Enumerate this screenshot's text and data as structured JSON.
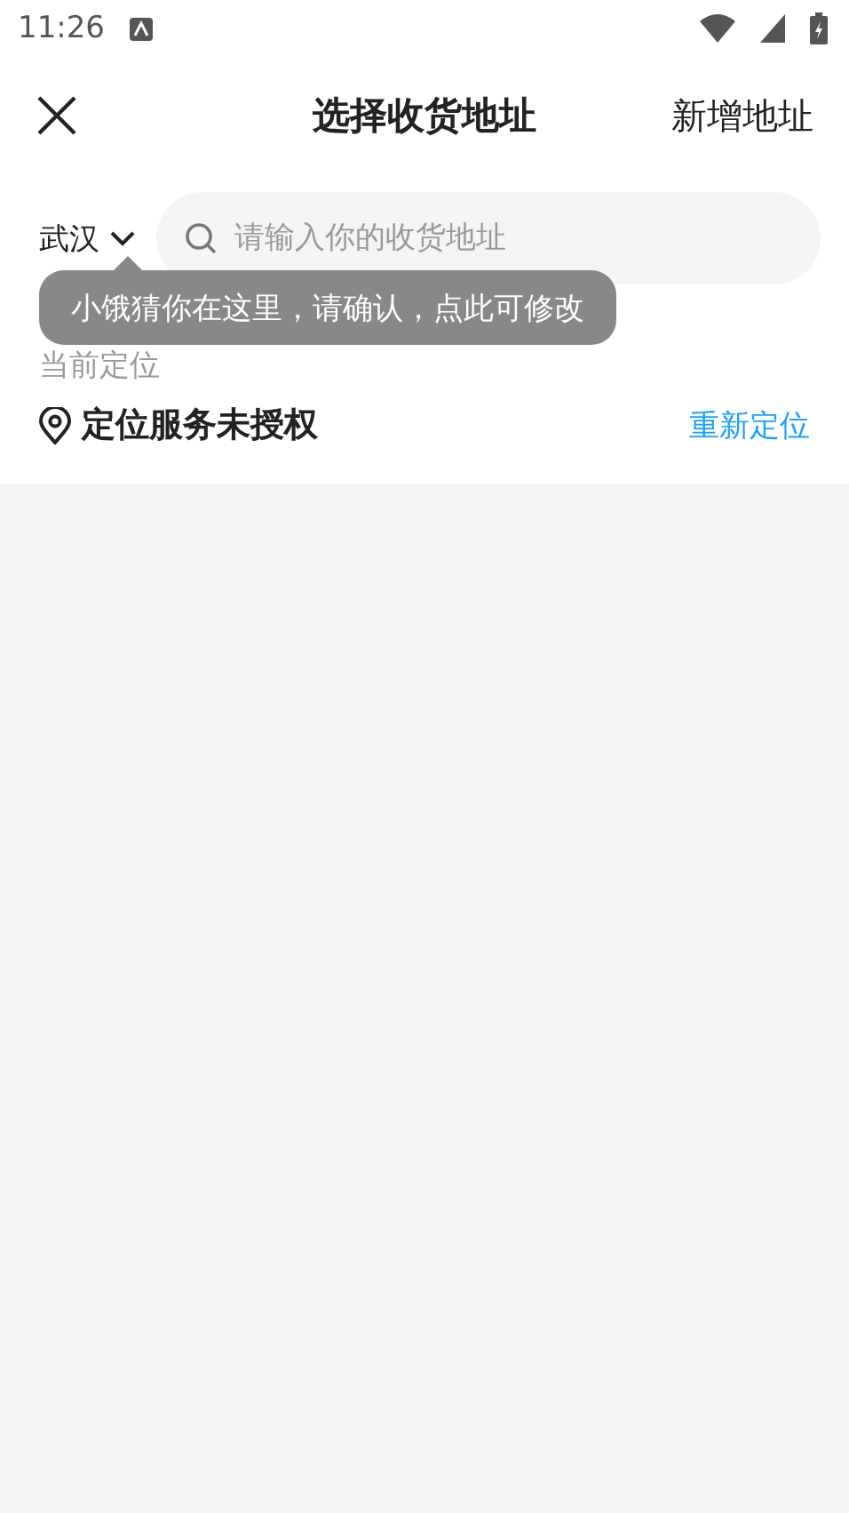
{
  "status_bar": {
    "time": "11:26"
  },
  "header": {
    "title": "选择收货地址",
    "action": "新增地址"
  },
  "search": {
    "city": "武汉",
    "placeholder": "请输入你的收货地址"
  },
  "tooltip": {
    "text": "小饿猜你在这里，请确认，点此可修改"
  },
  "current_location": {
    "label": "当前定位",
    "status": "定位服务未授权",
    "action": "重新定位"
  }
}
